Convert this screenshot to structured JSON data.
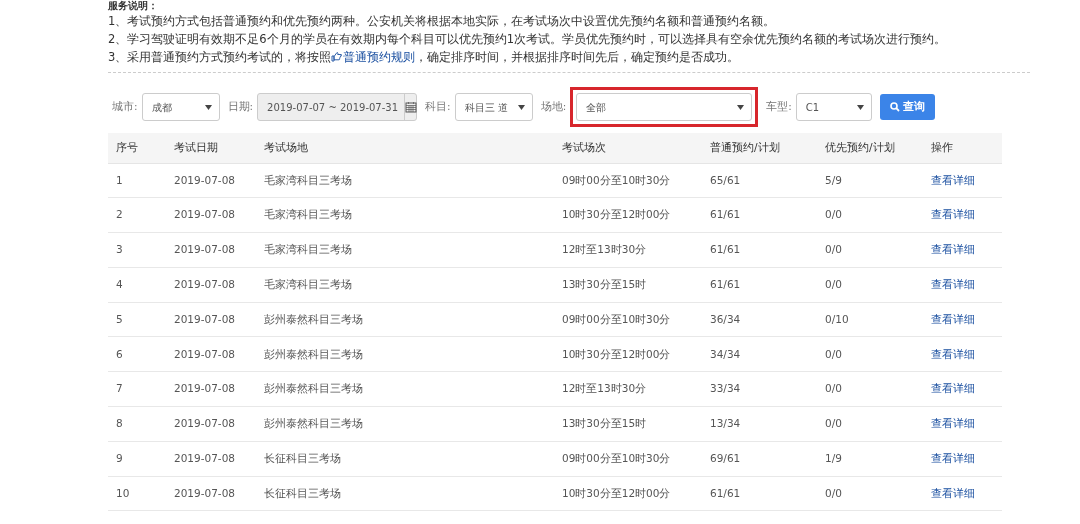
{
  "notes": {
    "title": "服务说明：",
    "items": [
      {
        "text": "1、考试预约方式包括普通预约和优先预约两种。公安机关将根据本地实际，在考试场次中设置优先预约名额和普通预约名额。"
      },
      {
        "text": "2、学习驾驶证明有效期不足6个月的学员在有效期内每个科目可以优先预约1次考试。学员优先预约时，可以选择具有空余优先预约名额的考试场次进行预约。"
      },
      {
        "text": "3、采用普通预约方式预约考试的，将按照",
        "link": "普通预约规则",
        "after": "，确定排序时间，并根据排序时间先后，确定预约是否成功。"
      }
    ]
  },
  "filters": [
    {
      "kind": "select",
      "label": "城市:",
      "value": "成都",
      "highlighted": false
    },
    {
      "kind": "date",
      "label": "日期:",
      "value": "2019-07-07 ~ 2019-07-31",
      "highlighted": false
    },
    {
      "kind": "select",
      "label": "科目:",
      "value": "科目三 道",
      "highlighted": false
    },
    {
      "kind": "select",
      "label": "场地:",
      "value": "全部",
      "highlighted": true
    },
    {
      "kind": "select",
      "label": "车型:",
      "value": "C1",
      "highlighted": false
    }
  ],
  "search_button": "查询",
  "table": {
    "columns": [
      "序号",
      "考试日期",
      "考试场地",
      "考试场次",
      "普通预约/计划",
      "优先预约/计划",
      "操作"
    ],
    "rows": [
      [
        "1",
        "2019-07-08",
        "毛家湾科目三考场",
        "09时00分至10时30分",
        "65/61",
        "5/9",
        "查看详细"
      ],
      [
        "2",
        "2019-07-08",
        "毛家湾科目三考场",
        "10时30分至12时00分",
        "61/61",
        "0/0",
        "查看详细"
      ],
      [
        "3",
        "2019-07-08",
        "毛家湾科目三考场",
        "12时至13时30分",
        "61/61",
        "0/0",
        "查看详细"
      ],
      [
        "4",
        "2019-07-08",
        "毛家湾科目三考场",
        "13时30分至15时",
        "61/61",
        "0/0",
        "查看详细"
      ],
      [
        "5",
        "2019-07-08",
        "彭州泰然科目三考场",
        "09时00分至10时30分",
        "36/34",
        "0/10",
        "查看详细"
      ],
      [
        "6",
        "2019-07-08",
        "彭州泰然科目三考场",
        "10时30分至12时00分",
        "34/34",
        "0/0",
        "查看详细"
      ],
      [
        "7",
        "2019-07-08",
        "彭州泰然科目三考场",
        "12时至13时30分",
        "33/34",
        "0/0",
        "查看详细"
      ],
      [
        "8",
        "2019-07-08",
        "彭州泰然科目三考场",
        "13时30分至15时",
        "13/34",
        "0/0",
        "查看详细"
      ],
      [
        "9",
        "2019-07-08",
        "长征科目三考场",
        "09时00分至10时30分",
        "69/61",
        "1/9",
        "查看详细"
      ],
      [
        "10",
        "2019-07-08",
        "长征科目三考场",
        "10时30分至12时00分",
        "61/61",
        "0/0",
        "查看详细"
      ]
    ]
  }
}
